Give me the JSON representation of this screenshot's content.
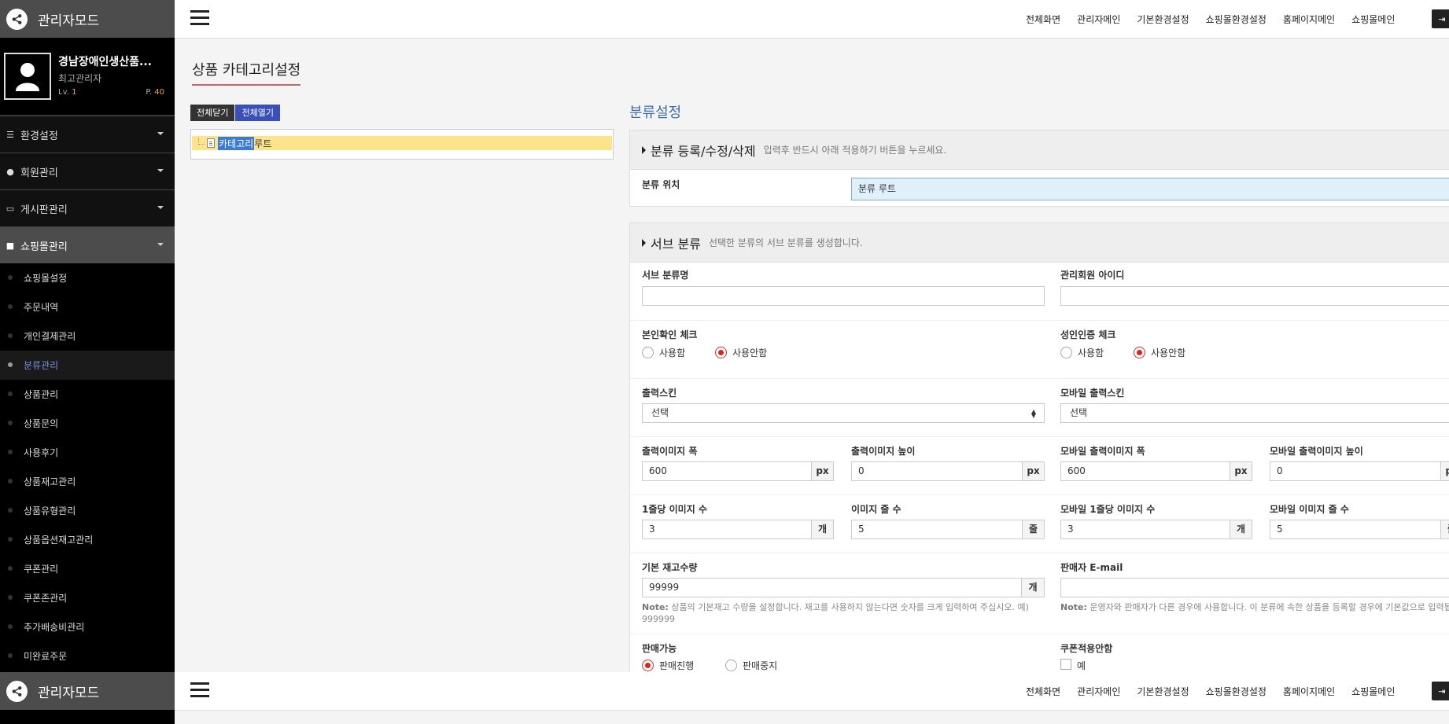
{
  "sidebar": {
    "title": "관리자모드",
    "profile": {
      "name": "경남장애인생산품...",
      "role": "최고관리자",
      "level_label": "Lv.",
      "level": "1",
      "points_label": "P.",
      "points": "40"
    },
    "groups": [
      {
        "label": "환경설정"
      },
      {
        "label": "회원관리"
      },
      {
        "label": "게시판관리"
      },
      {
        "label": "쇼핑몰관리"
      }
    ],
    "subitems": [
      "쇼핑몰설정",
      "주문내역",
      "개인결제관리",
      "분류관리",
      "상품관리",
      "상품문의",
      "사용후기",
      "상품재고관리",
      "상품유형관리",
      "상품옵션재고관리",
      "쿠폰관리",
      "쿠폰존관리",
      "추가배송비관리",
      "미완료주문"
    ]
  },
  "topnav": [
    "전체화면",
    "관리자메인",
    "기본환경설정",
    "쇼핑몰환경설정",
    "홈페이지메인",
    "쇼핑몰메인"
  ],
  "page_title": "상품 카테고리설정",
  "tree": {
    "collapse_all": "전체닫기",
    "expand_all": "전체열기",
    "node_selected": "카테고리",
    "node_rest": "루트"
  },
  "section_title": "분류설정",
  "panel1": {
    "title": "분류 등록/수정/삭제",
    "desc": "입력후 반드시 아래 적용하기 버튼을 누르세요.",
    "position_label": "분류 위치",
    "position_value": "분류 루트"
  },
  "panel2": {
    "title": "서브 분류",
    "desc": "선택한 분류의 서브 분류를 생성합니다.",
    "sub_name_label": "서브 분류명",
    "admin_id_label": "관리회원 아이디",
    "self_check_label": "본인확인 체크",
    "adult_check_label": "성인인증 체크",
    "use_label": "사용함",
    "nouse_label": "사용안함",
    "skin_label": "출력스킨",
    "mobile_skin_label": "모바일 출력스킨",
    "select_text": "선택",
    "img_width_label": "출력이미지 폭",
    "img_height_label": "출력이미지 높이",
    "m_img_width_label": "모바일 출력이미지 폭",
    "m_img_height_label": "모바일 출력이미지 높이",
    "img_width": "600",
    "img_height": "0",
    "m_img_width": "600",
    "m_img_height": "0",
    "px": "px",
    "row_count_label": "1줄당 이미지 수",
    "lines_label": "이미지 줄 수",
    "m_row_count_label": "모바일 1줄당 이미지 수",
    "m_lines_label": "모바일 이미지 줄 수",
    "row_count": "3",
    "lines": "5",
    "m_row_count": "3",
    "m_lines": "5",
    "unit_ea": "개",
    "unit_line": "줄",
    "stock_label": "기본 재고수량",
    "stock": "99999",
    "seller_email_label": "판매자 E-mail",
    "note_label": "Note:",
    "stock_note": "상품의 기본재고 수량을 설정합니다. 재고를 사용하지 않는다면 숫자를 크게 입력하여 주십시오. 예) 999999",
    "email_note": "운영자와 판매자가 다른 경우에 사용합니다. 이 분류에 속한 상품을 등록할 경우에 기본값으로 입력됩니다.",
    "sale_label": "판매가능",
    "sale_on": "판매진행",
    "sale_off": "판매중지",
    "coupon_label": "쿠폰적용안함",
    "coupon_yes": "예"
  }
}
